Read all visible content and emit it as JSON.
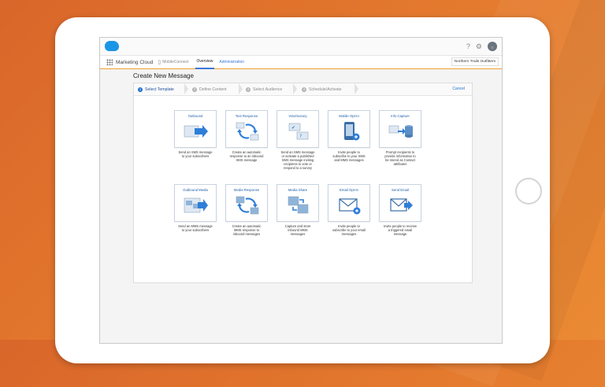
{
  "header": {
    "icons": [
      "help-icon",
      "gear-icon",
      "avatar-icon"
    ],
    "help_glyph": "?",
    "gear_glyph": "⚙",
    "avatar_glyph": "●"
  },
  "nav": {
    "app_name": "Marketing Cloud",
    "app_sub": "MobileConnect",
    "tabs": [
      {
        "label": "Overview",
        "active": true
      },
      {
        "label": "Administration",
        "active": false
      }
    ],
    "account": "Northern Trails Outfitters"
  },
  "page": {
    "title": "Create New Message"
  },
  "wizard": {
    "steps": [
      {
        "num": "1",
        "label": "Select Template",
        "active": true
      },
      {
        "num": "2",
        "label": "Define Content",
        "active": false
      },
      {
        "num": "3",
        "label": "Select Audience",
        "active": false
      },
      {
        "num": "4",
        "label": "Schedule/Activate",
        "active": false
      }
    ],
    "cancel_label": "Cancel"
  },
  "colors": {
    "accent": "#1f6fd0",
    "nav_underline": "#f0a030",
    "brand": "#1b96e6"
  },
  "templates": [
    {
      "title": "Outbound",
      "icon": "outbound-arrow-icon",
      "desc": [
        "Send an SMS message",
        "to your subscribers"
      ]
    },
    {
      "title": "Text Response",
      "icon": "text-response-icon",
      "desc": [
        "Create an automatic",
        "response to an inbound",
        "SMS message"
      ]
    },
    {
      "title": "Vote/Survey",
      "icon": "vote-survey-icon",
      "desc": [
        "Send an SMS message",
        "or activate a published",
        "SMS message inviting",
        "recipients to vote or",
        "respond to a survey"
      ]
    },
    {
      "title": "Mobile Opt-In",
      "icon": "mobile-opt-in-icon",
      "desc": [
        "Invite people to",
        "subscribe to your SMS",
        "and MMS messages"
      ]
    },
    {
      "title": "Info Capture",
      "icon": "info-capture-icon",
      "desc": [
        "Prompt recipients to",
        "provide information to",
        "be stored as Contact",
        "attributes"
      ]
    },
    {
      "title": "Outbound Media",
      "icon": "outbound-media-icon",
      "desc": [
        "Send an MMS message",
        "to your subscribers"
      ]
    },
    {
      "title": "Media Response",
      "icon": "media-response-icon",
      "desc": [
        "Create an automatic",
        "MMS response to",
        "inbound messages"
      ]
    },
    {
      "title": "Media Share",
      "icon": "media-share-icon",
      "desc": [
        "Capture and store",
        "inbound MMS",
        "messages"
      ]
    },
    {
      "title": "Email Opt-In",
      "icon": "email-opt-in-icon",
      "desc": [
        "Invite people to",
        "subscribe to your email",
        "messages"
      ]
    },
    {
      "title": "Send Email",
      "icon": "send-email-icon",
      "desc": [
        "Invite people to receive",
        "a triggered email",
        "message"
      ]
    }
  ]
}
